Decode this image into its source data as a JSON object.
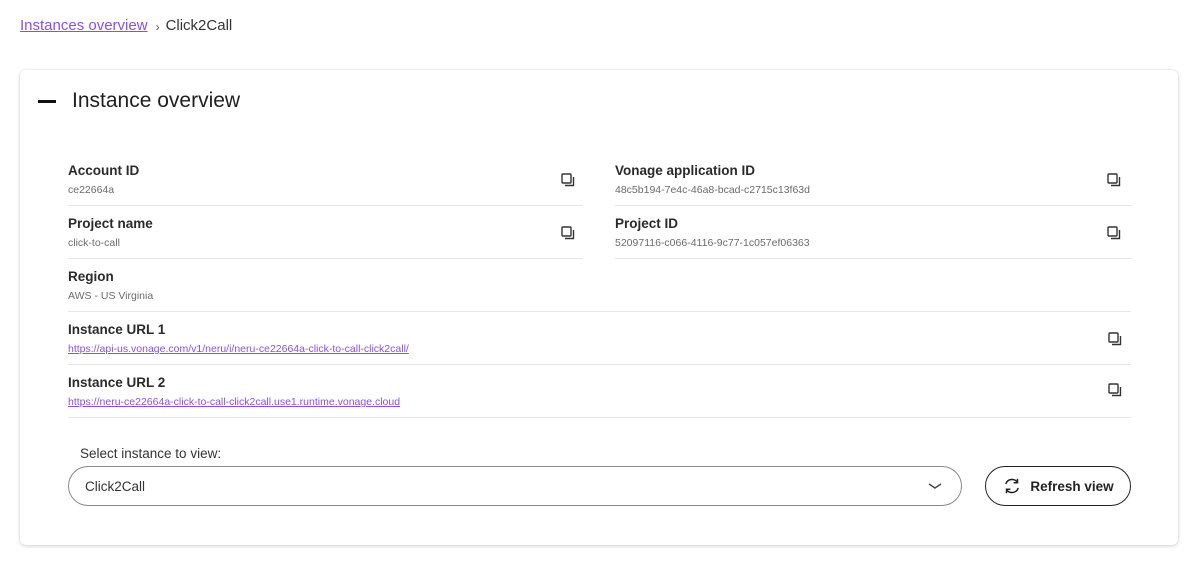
{
  "breadcrumb": {
    "parent": "Instances overview",
    "separator": "›",
    "current": "Click2Call"
  },
  "card": {
    "title": "Instance overview",
    "collapse_icon": "minus-icon"
  },
  "fields": {
    "account_id": {
      "label": "Account ID",
      "value": "ce22664a"
    },
    "vonage_app_id": {
      "label": "Vonage application ID",
      "value": "48c5b194-7e4c-46a8-bcad-c2715c13f63d"
    },
    "project_name": {
      "label": "Project name",
      "value": "click-to-call"
    },
    "project_id": {
      "label": "Project ID",
      "value": "52097116-c066-4116-9c77-1c057ef06363"
    },
    "region": {
      "label": "Region",
      "value": "AWS - US Virginia"
    },
    "instance_url_1": {
      "label": "Instance URL 1",
      "value": "https://api-us.vonage.com/v1/neru/i/neru-ce22664a-click-to-call-click2call/"
    },
    "instance_url_2": {
      "label": "Instance URL 2",
      "value": "https://neru-ce22664a-click-to-call-click2call.use1.runtime.vonage.cloud"
    }
  },
  "selector": {
    "label": "Select instance to view:",
    "selected": "Click2Call"
  },
  "refresh": {
    "label": "Refresh view"
  },
  "colors": {
    "link": "#8a4fe6",
    "text": "#1f1f1f",
    "muted": "#6a6a6a"
  }
}
